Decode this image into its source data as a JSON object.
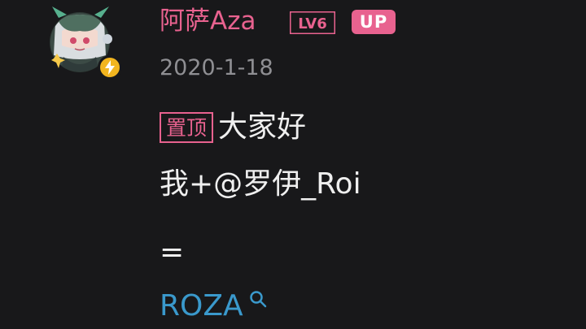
{
  "user": {
    "name": "阿萨Aza",
    "level": "LV6",
    "badge": "UP"
  },
  "post": {
    "date": "2020-1-18",
    "pin_tag": "置顶",
    "line1": "大家好",
    "line2": "我+@罗伊_Roi",
    "line3": "=",
    "link_text": "ROZA"
  },
  "icons": {
    "verified": "lightning-icon",
    "search": "search-icon"
  },
  "colors": {
    "background": "#18181a",
    "username": "#e8628f",
    "level_badge": "#e8628f",
    "up_badge": "#e8628f",
    "date": "#8f8f93",
    "text": "#efefef",
    "link": "#3a99cc",
    "verified": "#f2b51f"
  }
}
